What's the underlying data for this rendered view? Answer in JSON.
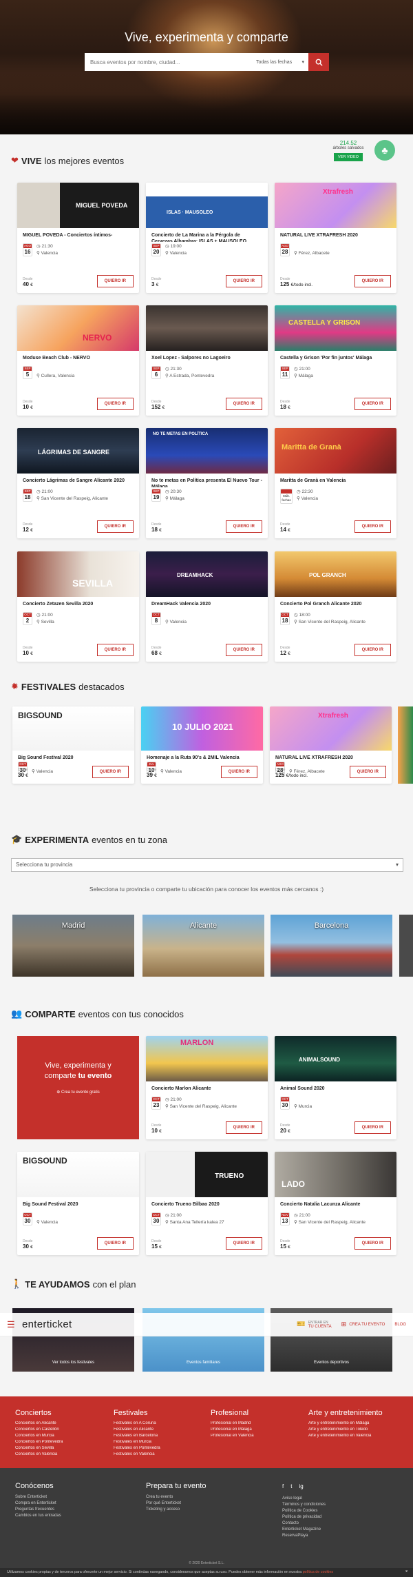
{
  "hero": {
    "title": "Vive, experimenta y comparte",
    "search_placeholder": "Busca eventos por nombre, ciudad...",
    "date_select": "Todas las fechas"
  },
  "sections": {
    "vive": {
      "bold": "VIVE",
      "rest": "los mejores eventos"
    },
    "festivales": {
      "bold": "FESTIVALES",
      "rest": "destacados"
    },
    "experimenta": {
      "bold": "EXPERIMENTA",
      "rest": "eventos en tu zona"
    },
    "comparte": {
      "bold": "COMPARTE",
      "rest": "eventos con tus conocidos"
    },
    "ayudamos": {
      "bold": "TE AYUDAMOS",
      "rest": "con el plan"
    }
  },
  "trees": {
    "count": "214.52",
    "label": "árboles salvados",
    "button": "VER VIDEO"
  },
  "price_label": "Desde",
  "cta": "QUIERO IR",
  "events": [
    {
      "title": "MIGUEL POVEDA - Conciertos íntimos-",
      "month": "AGO",
      "day": "16",
      "time": "21:30",
      "place": "Valencia",
      "price": "40",
      "currency": "€"
    },
    {
      "title": "Concierto de La Marina a la Pérgola de Cervezas Alhambra: ISLAS + MAUSOLEO",
      "month": "SEP",
      "day": "20",
      "time": "19:00",
      "place": "Valencia",
      "price": "3",
      "currency": "€"
    },
    {
      "title": "NATURAL LIVE XTRAFRESH 2020",
      "month": "AGO",
      "day": "28",
      "time": "",
      "place": "Férez, Albacete",
      "price": "125",
      "currency": "€/todo incl."
    },
    {
      "title": "Moduse Beach Club - NERVO",
      "month": "SEP",
      "day": "5",
      "time": "",
      "place": "Cullera, Valencia",
      "price": "10",
      "currency": "€"
    },
    {
      "title": "Xoel Lopez - Salpores no Lagoeiro",
      "month": "SEP",
      "day": "6",
      "time": "21:30",
      "place": "A Estrada, Pontevedra",
      "price": "152",
      "currency": "€"
    },
    {
      "title": "Castella y Grison 'Por fin juntos' Málaga",
      "month": "SEP",
      "day": "11",
      "time": "21:00",
      "place": "Málaga",
      "price": "18",
      "currency": "€"
    },
    {
      "title": "Concierto Lágrimas de Sangre Alicante 2020",
      "month": "SEP",
      "day": "18",
      "time": "21:00",
      "place": "San Vicente del Raspeig, Alicante",
      "price": "12",
      "currency": "€"
    },
    {
      "title": "No te metas en Política presenta El Nuevo Tour - Málaga",
      "month": "SEP",
      "day": "19",
      "time": "20:30",
      "place": "Málaga",
      "price": "18",
      "currency": "€"
    },
    {
      "title": "Maritta de Granà en Valencia",
      "month": "",
      "day": "",
      "multi": "Múlt. fechas",
      "time": "22:30",
      "place": "Valencia",
      "price": "14",
      "currency": "€"
    },
    {
      "title": "Concierto Zetazen Sevilla 2020",
      "month": "OCT",
      "day": "2",
      "time": "21:00",
      "place": "Sevilla",
      "price": "10",
      "currency": "€"
    },
    {
      "title": "DreamHack Valencia 2020",
      "month": "OCT",
      "day": "8",
      "time": "",
      "place": "Valencia",
      "price": "68",
      "currency": "€"
    },
    {
      "title": "Concierto Pol Granch Alicante 2020",
      "month": "OCT",
      "day": "18",
      "time": "18:00",
      "place": "San Vicente del Raspeig, Alicante",
      "price": "12",
      "currency": "€"
    }
  ],
  "festivals": [
    {
      "title": "Big Sound Festival 2020",
      "month": "OCT",
      "day": "30",
      "time": "",
      "place": "Valencia",
      "price": "30",
      "currency": "€"
    },
    {
      "title": "Homenaje a la Ruta 90's & 2MIL Valencia",
      "month": "JUL",
      "day": "10",
      "time": "",
      "place": "Valencia",
      "price": "39",
      "currency": "€"
    },
    {
      "title": "NATURAL LIVE XTRAFRESH 2020",
      "month": "AGO",
      "day": "28",
      "time": "",
      "place": "Férez, Albacete",
      "price": "125",
      "currency": "€/todo incl."
    }
  ],
  "province": {
    "placeholder": "Selecciona tu provincia",
    "help": "Selecciona tu provincia o comparte tu ubicación para conocer los eventos más cercanos :)"
  },
  "cities": [
    "Madrid",
    "Alicante",
    "Barcelona"
  ],
  "create": {
    "line1": "Vive, experimenta y",
    "line2a": "comparte ",
    "line2b": "tu evento",
    "sub": "Crea tu evento gratis"
  },
  "share_events": [
    {
      "title": "Concierto Marlon Alicante",
      "month": "OCT",
      "day": "23",
      "time": "21:00",
      "place": "San Vicente del Raspeig, Alicante",
      "price": "10",
      "currency": "€"
    },
    {
      "title": "Animal Sound 2020",
      "month": "OCT",
      "day": "30",
      "time": "",
      "place": "Murcia",
      "price": "20",
      "currency": "€"
    },
    {
      "title": "Big Sound Festival 2020",
      "month": "OCT",
      "day": "30",
      "time": "",
      "place": "Valencia",
      "price": "30",
      "currency": "€"
    },
    {
      "title": "Concierto Trueno Bilbao 2020",
      "month": "OCT",
      "day": "30",
      "time": "21:00",
      "place": "Santa Ana Tellería kalea 27",
      "price": "15",
      "currency": "€"
    },
    {
      "title": "Concierto Natalia Lacunza Alicante",
      "month": "NOV",
      "day": "13",
      "time": "21:00",
      "place": "San Vicente del Raspeig, Alicante",
      "price": "15",
      "currency": "€"
    }
  ],
  "help_cards": [
    "Ver todos los festivales",
    "Eventos familiares",
    "Eventos deportivos"
  ],
  "navbar": {
    "logo": "enterticket",
    "account_top": "ENTRAR EN",
    "account": "TU CUENTA",
    "create": "CREA TU EVENTO",
    "blog": "BLOG"
  },
  "footer_red": [
    {
      "title": "Conciertos",
      "items": [
        "Conciertos en Alicante",
        "Conciertos en Castellón",
        "Conciertos en Murcia",
        "Conciertos en Pontevedra",
        "Conciertos en Sevilla",
        "Conciertos en Valencia"
      ]
    },
    {
      "title": "Festivales",
      "items": [
        "Festivales en A Coruña",
        "Festivales en Alicante",
        "Festivales en Barcelona",
        "Festivales en Murcia",
        "Festivales en Pontevedra",
        "Festivales en Valencia"
      ]
    },
    {
      "title": "Profesional",
      "items": [
        "Profesional en Madrid",
        "Profesional en Málaga",
        "Profesional en Valencia"
      ]
    },
    {
      "title": "Arte y entretenimiento",
      "items": [
        "Arte y entretenimiento en Málaga",
        "Arte y entretenimiento en Toledo",
        "Arte y entretenimiento en Valencia"
      ]
    }
  ],
  "footer_dark": [
    {
      "title": "Conócenos",
      "items": [
        "Sobre Enterticket",
        "Compra en Enterticket",
        "Preguntas frecuentes",
        "Cambios en tus entradas"
      ]
    },
    {
      "title": "Prepara tu evento",
      "items": [
        "Crea tu evento",
        "Por qué Enterticket",
        "Ticketing y acceso"
      ]
    },
    {
      "title": "",
      "items": [
        "Aviso legal",
        "Términos y condiciones",
        "Política de Cookies",
        "Política de privacidad",
        "Contacto",
        "Enterticket Magazine",
        "ReservaPlaya"
      ]
    }
  ],
  "social": [
    "f",
    "t",
    "ig"
  ],
  "copyright": "© 2020 Enterticket S.L.",
  "cookie": {
    "text": "Utilizamos cookies propias y de terceros para ofrecerte un mejor servicio. Si continúas navegando, consideramos que aceptas su uso. Puedes obtener más información en nuestra ",
    "link": "política de cookies",
    "close": "x"
  },
  "colors": {
    "brand": "#c4302b",
    "green": "#19a34a",
    "footer_dark": "#3b3b3b"
  }
}
